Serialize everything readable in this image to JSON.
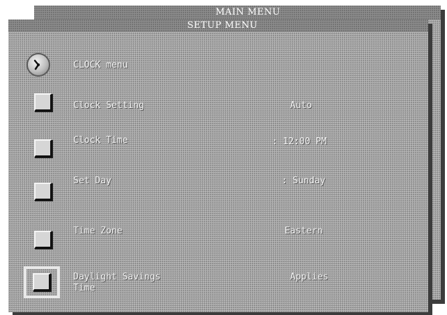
{
  "main_menu": {
    "title": "MAIN MENU"
  },
  "setup_menu": {
    "title": "SETUP MENU"
  },
  "clock_menu": {
    "title": "CLOCK menu",
    "icon": "clock-icon",
    "items": [
      {
        "label": "Clock Setting",
        "value": "Auto"
      },
      {
        "label": "Clock Time",
        "value": ": 12:00 PM"
      },
      {
        "label": "Set Day",
        "value": ": Sunday"
      },
      {
        "label": "Time Zone",
        "value": "Eastern"
      },
      {
        "label_line1": "Daylight Savings",
        "label_line2": "Time",
        "value": "Applies"
      }
    ]
  }
}
